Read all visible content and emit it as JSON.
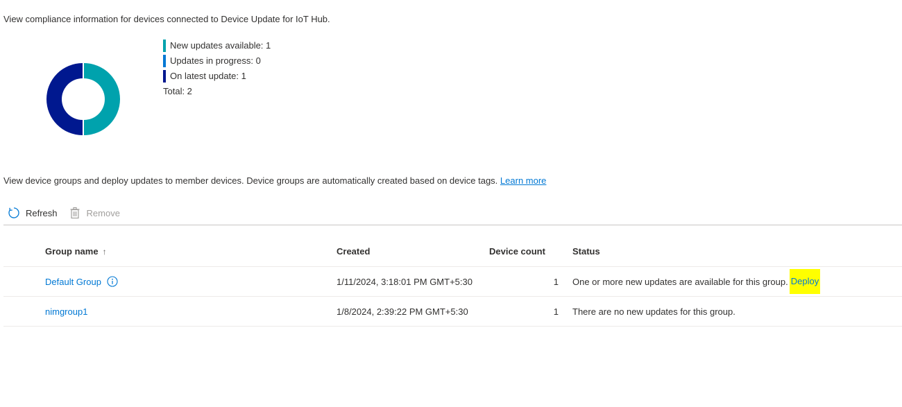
{
  "compliance": {
    "description": "View compliance information for devices connected to Device Update for IoT Hub.",
    "legend": [
      {
        "label": "New updates available: 1",
        "color": "#00a2ad",
        "value": 1
      },
      {
        "label": "Updates in progress: 0",
        "color": "#0078d4",
        "value": 0
      },
      {
        "label": "On latest update: 1",
        "color": "#00188f",
        "value": 1
      }
    ],
    "total_label": "Total: 2"
  },
  "groups": {
    "description": "View device groups and deploy updates to member devices. Device groups are automatically created based on device tags.",
    "learn_more": "Learn more"
  },
  "toolbar": {
    "refresh_label": "Refresh",
    "remove_label": "Remove"
  },
  "table": {
    "headers": {
      "name": "Group name",
      "sort_indicator": "↑",
      "created": "Created",
      "count": "Device count",
      "status": "Status"
    },
    "rows": [
      {
        "name": "Default Group",
        "created": "1/11/2024, 3:18:01 PM GMT+5:30",
        "count": "1",
        "status": "One or more new updates are available for this group.",
        "action": "Deploy"
      },
      {
        "name": "nimgroup1",
        "created": "1/8/2024, 2:39:22 PM GMT+5:30",
        "count": "1",
        "status": "There are no new updates for this group."
      }
    ]
  }
}
